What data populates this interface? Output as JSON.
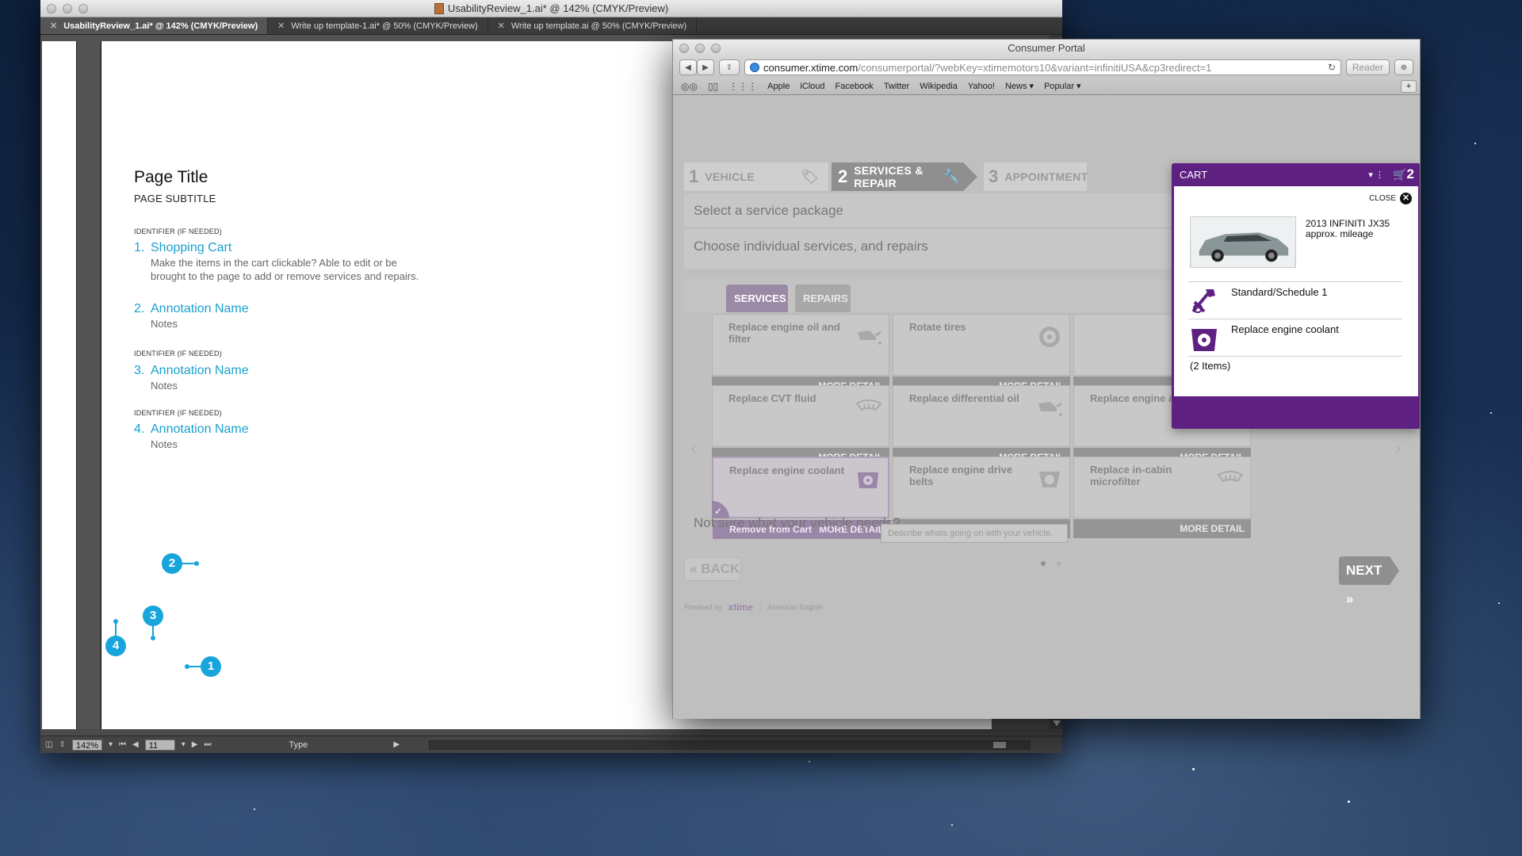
{
  "illustrator": {
    "window_title": "UsabilityReview_1.ai* @ 142% (CMYK/Preview)",
    "tabs": [
      {
        "label": "UsabilityReview_1.ai* @ 142% (CMYK/Preview)",
        "active": true
      },
      {
        "label": "Write up template-1.ai* @ 50% (CMYK/Preview)",
        "active": false
      },
      {
        "label": "Write up template.ai @ 50% (CMYK/Preview)",
        "active": false
      }
    ],
    "artboard": {
      "page_title": "Page Title",
      "page_subtitle": "PAGE SUBTITLE",
      "identifier": "IDENTIFIER (IF NEEDED)",
      "annotations": [
        {
          "num": "1.",
          "name": "Shopping Cart",
          "notes": "Make the items in the cart clickable? Able to edit or be brought to the page to add or remove services and repairs."
        },
        {
          "num": "2.",
          "name": "Annotation Name",
          "notes": "Notes"
        },
        {
          "num": "3.",
          "name": "Annotation Name",
          "notes": "Notes"
        },
        {
          "num": "4.",
          "name": "Annotation Name",
          "notes": "Notes"
        }
      ],
      "markers": [
        "1",
        "2",
        "3",
        "4"
      ]
    },
    "statusbar": {
      "zoom": "142%",
      "artboard_num": "11",
      "tool": "Type"
    }
  },
  "safari": {
    "window_title": "Consumer Portal",
    "url_host": "consumer.xtime.com",
    "url_path": "/consumerportal/?webKey=xtimemotors10&variant=infinitiUSA&cp3redirect=1",
    "reader_label": "Reader",
    "bookmarks": [
      "Apple",
      "iCloud",
      "Facebook",
      "Twitter",
      "Wikipedia",
      "Yahoo!",
      "News ▾",
      "Popular ▾"
    ]
  },
  "portal": {
    "steps": [
      {
        "num": "1",
        "label": "VEHICLE"
      },
      {
        "num": "2",
        "label": "SERVICES & REPAIR"
      },
      {
        "num": "3",
        "label": "APPOINTMENT"
      }
    ],
    "select_package": "Select a service package",
    "choose_individual": "Choose individual services, and repairs",
    "subtabs": {
      "services": "SERVICES",
      "repairs": "REPAIRS"
    },
    "more_detail": "MORE DETAIL",
    "remove_from_cart": "Remove from Cart",
    "cards": [
      {
        "title": "Replace engine oil and filter",
        "icon": "oil-can-icon",
        "selected": false
      },
      {
        "title": "Rotate tires",
        "icon": "tire-icon",
        "selected": false
      },
      {
        "title": "",
        "icon": "",
        "selected": false
      },
      {
        "title": "Replace CVT fluid",
        "icon": "grille-icon",
        "selected": false
      },
      {
        "title": "Replace differential oil",
        "icon": "oil-can-icon",
        "selected": false
      },
      {
        "title": "Replace engine air filter",
        "icon": "filter-icon",
        "selected": false
      },
      {
        "title": "Replace engine coolant",
        "icon": "engine-icon",
        "selected": true
      },
      {
        "title": "Replace engine drive belts",
        "icon": "belt-icon",
        "selected": false
      },
      {
        "title": "Replace in-cabin microfilter",
        "icon": "grille-icon",
        "selected": false
      }
    ],
    "needs_label": "Not sure what your vehicle needs?",
    "needs_placeholder": "Describe whats going on with your vehicle.",
    "back_label": "BACK",
    "next_label": "NEXT",
    "footer_powered": "Powered by",
    "footer_brand": "xtime",
    "footer_lang": "American English"
  },
  "cart": {
    "title": "CART",
    "count": "2",
    "close_label": "CLOSE",
    "vehicle_line1": "2013 INFINITI JX35",
    "vehicle_line2": "approx. mileage",
    "items": [
      {
        "label": "Standard/Schedule 1",
        "icon": "tools-icon"
      },
      {
        "label": "Replace engine coolant",
        "icon": "engine-icon"
      }
    ],
    "items_count": "(2 Items)"
  },
  "colors": {
    "cart_purple": "#5e2182",
    "annotation_blue": "#17a5dc",
    "services_tab": "#9a8aa5"
  }
}
